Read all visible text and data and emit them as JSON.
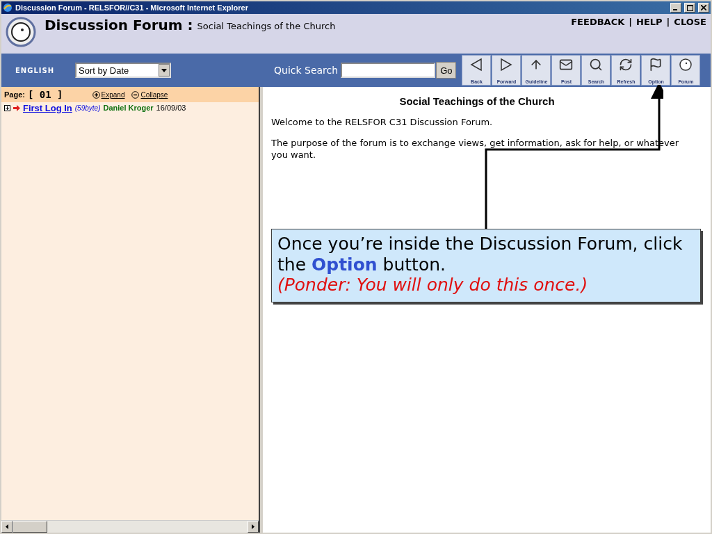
{
  "window": {
    "title": "Discussion Forum - RELSFOR//C31 - Microsoft Internet Explorer"
  },
  "header": {
    "title": "Discussion Forum :",
    "subtitle": "Social Teachings of the Church",
    "links": [
      "FEEDBACK",
      "HELP",
      "CLOSE"
    ],
    "separator": "|"
  },
  "toolbar": {
    "language": "ENGLISH",
    "sort": "Sort by Date",
    "search_label": "Quick Search",
    "go": "Go",
    "buttons": [
      {
        "kind": "back",
        "label": "Back"
      },
      {
        "kind": "forward",
        "label": "Forward"
      },
      {
        "kind": "guideline",
        "label": "Guideline"
      },
      {
        "kind": "post",
        "label": "Post"
      },
      {
        "kind": "search",
        "label": "Search"
      },
      {
        "kind": "refresh",
        "label": "Refresh"
      },
      {
        "kind": "option",
        "label": "Option"
      },
      {
        "kind": "forum",
        "label": "Forum"
      }
    ]
  },
  "sidebar": {
    "page_label": "Page:",
    "page": "[ 01 ]",
    "expand": "Expand",
    "collapse": "Collapse",
    "threads": [
      {
        "title": "First Log In",
        "size": "(59byte)",
        "author": "Daniel Kroger",
        "date": "16/09/03"
      }
    ]
  },
  "content": {
    "heading": "Social Teachings of the Church",
    "paragraphs": [
      "Welcome to the RELSFOR C31 Discussion Forum.",
      "The purpose of the forum is to exchange views, get information, ask for help, or whatever you want."
    ]
  },
  "callout": {
    "text": "Once you’re inside the Discussion Forum, click the **Option** button.",
    "note": "(Ponder: You will only do this once.)"
  }
}
